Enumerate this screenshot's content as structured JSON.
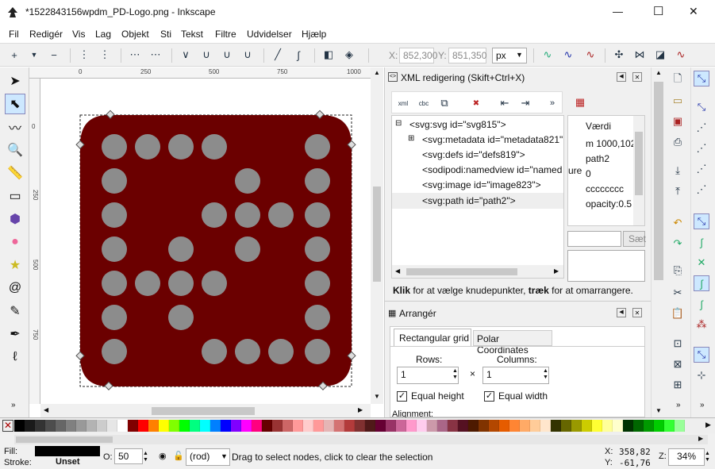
{
  "window": {
    "title": "*1522843156wpdm_PD-Logo.png - Inkscape",
    "minimize": "—",
    "maximize": "☐",
    "close": "✕"
  },
  "menu": [
    "Fil",
    "Redigér",
    "Vis",
    "Lag",
    "Objekt",
    "Sti",
    "Tekst",
    "Filtre",
    "Udvidelser",
    "Hjælp"
  ],
  "coords": {
    "x_label": "X:",
    "x_value": "852,300",
    "y_label": "Y:",
    "y_value": "851,350",
    "unit": "px"
  },
  "ruler": {
    "h_ticks": [
      "0",
      "250",
      "500",
      "750",
      "1000"
    ],
    "v_ticks": [
      "0",
      "250",
      "500",
      "750",
      "1000"
    ]
  },
  "xml_panel": {
    "title": "XML redigering  (Skift+Ctrl+X)",
    "nodes": [
      "<svg:svg id=\"svg815\">",
      "<svg:metadata id=\"metadata821\"",
      "<svg:defs id=\"defs819\">",
      "<sodipodi:namedview id=\"named",
      "<svg:image id=\"image823\">",
      "<svg:path id=\"path2\">"
    ],
    "attr_header": "Værdi",
    "attr_values": [
      "m 1000,102",
      "path2",
      "0",
      "cccccccc",
      "opacity:0.5"
    ],
    "attr_clipped": "ure",
    "set_button": "Sæt",
    "hint_bold1": "Klik",
    "hint_text1": " for at vælge knudepunkter, ",
    "hint_bold2": "træk",
    "hint_text2": " for at omarrangere."
  },
  "arrange_panel": {
    "title": "Arrangér",
    "tabs": [
      "Rectangular grid",
      "Polar Coordinates"
    ],
    "rows_label": "Rows:",
    "columns_label": "Columns:",
    "rows_value": "1",
    "columns_value": "1",
    "times": "×",
    "equal_height": "Equal height",
    "equal_width": "Equal width",
    "alignment": "Alignment:"
  },
  "status": {
    "fill_label": "Fill:",
    "stroke_label": "Stroke:",
    "stroke_value": "Unset",
    "opacity_label": "O:",
    "opacity_value": "50",
    "layer": "(rod)",
    "message": "Drag to select nodes, click to clear the selection",
    "cursor_x_label": "X:",
    "cursor_x": "358,82",
    "cursor_y_label": "Y:",
    "cursor_y": "-61,76",
    "zoom_label": "Z:",
    "zoom_value": "34%"
  },
  "colors": {
    "logo_bg": "#6b0000",
    "dot": "#8c8c8c",
    "accent": "#cde8ff"
  }
}
